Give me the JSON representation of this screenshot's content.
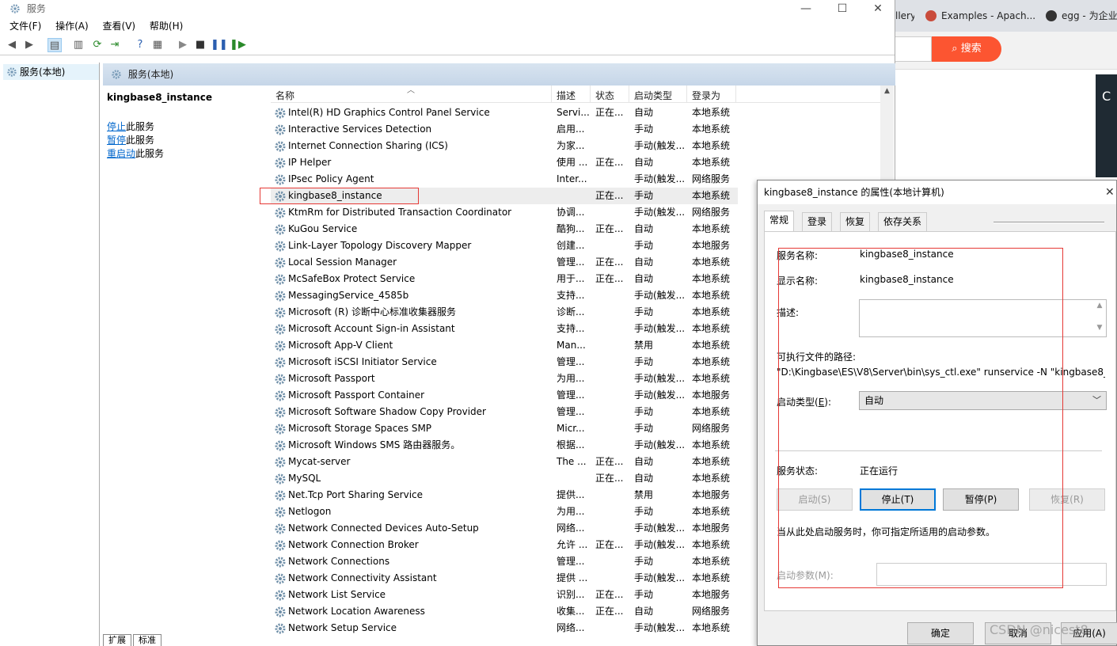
{
  "browser": {
    "tabs": [
      "llery",
      "Examples - Apach...",
      "egg - 为企业"
    ],
    "search_button": "搜索",
    "panel_letter": "C"
  },
  "window": {
    "title": "服务",
    "menu": [
      "文件(F)",
      "操作(A)",
      "查看(V)",
      "帮助(H)"
    ]
  },
  "tree": {
    "root": "服务(本地)"
  },
  "panel": {
    "header": "服务(本地)",
    "selected_service": "kingbase8_instance",
    "actions": [
      {
        "link": "停止",
        "rest": "此服务"
      },
      {
        "link": "暂停",
        "rest": "此服务"
      },
      {
        "link": "重启动",
        "rest": "此服务"
      }
    ]
  },
  "list": {
    "columns": {
      "name": "名称",
      "desc": "描述",
      "status": "状态",
      "startup": "启动类型",
      "logon": "登录为"
    },
    "rows": [
      [
        "Intel(R) HD Graphics Control Panel Service",
        "Servi...",
        "正在...",
        "自动",
        "本地系统"
      ],
      [
        "Interactive Services Detection",
        "启用...",
        "",
        "手动",
        "本地系统"
      ],
      [
        "Internet Connection Sharing (ICS)",
        "为家...",
        "",
        "手动(触发...",
        "本地系统"
      ],
      [
        "IP Helper",
        "使用 ...",
        "正在...",
        "自动",
        "本地系统"
      ],
      [
        "IPsec Policy Agent",
        "Inter...",
        "",
        "手动(触发...",
        "网络服务"
      ],
      [
        "kingbase8_instance",
        "",
        "正在...",
        "手动",
        "本地系统"
      ],
      [
        "KtmRm for Distributed Transaction Coordinator",
        "协调...",
        "",
        "手动(触发...",
        "网络服务"
      ],
      [
        "KuGou Service",
        "酷狗...",
        "正在...",
        "自动",
        "本地系统"
      ],
      [
        "Link-Layer Topology Discovery Mapper",
        "创建...",
        "",
        "手动",
        "本地服务"
      ],
      [
        "Local Session Manager",
        "管理...",
        "正在...",
        "自动",
        "本地系统"
      ],
      [
        "McSafeBox Protect Service",
        "用于...",
        "正在...",
        "自动",
        "本地系统"
      ],
      [
        "MessagingService_4585b",
        "支持...",
        "",
        "手动(触发...",
        "本地系统"
      ],
      [
        "Microsoft (R) 诊断中心标准收集器服务",
        "诊断...",
        "",
        "手动",
        "本地系统"
      ],
      [
        "Microsoft Account Sign-in Assistant",
        "支持...",
        "",
        "手动(触发...",
        "本地系统"
      ],
      [
        "Microsoft App-V Client",
        "Man...",
        "",
        "禁用",
        "本地系统"
      ],
      [
        "Microsoft iSCSI Initiator Service",
        "管理...",
        "",
        "手动",
        "本地系统"
      ],
      [
        "Microsoft Passport",
        "为用...",
        "",
        "手动(触发...",
        "本地系统"
      ],
      [
        "Microsoft Passport Container",
        "管理...",
        "",
        "手动(触发...",
        "本地服务"
      ],
      [
        "Microsoft Software Shadow Copy Provider",
        "管理...",
        "",
        "手动",
        "本地系统"
      ],
      [
        "Microsoft Storage Spaces SMP",
        "Micr...",
        "",
        "手动",
        "网络服务"
      ],
      [
        "Microsoft Windows SMS 路由器服务。",
        "根据...",
        "",
        "手动(触发...",
        "本地系统"
      ],
      [
        "Mycat-server",
        "The ...",
        "正在...",
        "自动",
        "本地系统"
      ],
      [
        "MySQL",
        "",
        "正在...",
        "自动",
        "本地系统"
      ],
      [
        "Net.Tcp Port Sharing Service",
        "提供...",
        "",
        "禁用",
        "本地服务"
      ],
      [
        "Netlogon",
        "为用...",
        "",
        "手动",
        "本地系统"
      ],
      [
        "Network Connected Devices Auto-Setup",
        "网络...",
        "",
        "手动(触发...",
        "本地服务"
      ],
      [
        "Network Connection Broker",
        "允许 ...",
        "正在...",
        "手动(触发...",
        "本地系统"
      ],
      [
        "Network Connections",
        "管理...",
        "",
        "手动",
        "本地系统"
      ],
      [
        "Network Connectivity Assistant",
        "提供 ...",
        "",
        "手动(触发...",
        "本地系统"
      ],
      [
        "Network List Service",
        "识别...",
        "正在...",
        "手动",
        "本地服务"
      ],
      [
        "Network Location Awareness",
        "收集...",
        "正在...",
        "自动",
        "网络服务"
      ],
      [
        "Network Setup Service",
        "网络...",
        "",
        "手动(触发...",
        "本地系统"
      ]
    ]
  },
  "bottom_tabs": [
    "扩展",
    "标准"
  ],
  "dialog": {
    "title": "kingbase8_instance 的属性(本地计算机)",
    "tabs": [
      "常规",
      "登录",
      "恢复",
      "依存关系"
    ],
    "service_name_label": "服务名称:",
    "service_name": "kingbase8_instance",
    "display_name_label": "显示名称:",
    "display_name": "kingbase8_instance",
    "description_label": "描述:",
    "exe_path_label": "可执行文件的路径:",
    "exe_path": "\"D:\\Kingbase\\ES\\V8\\Server\\bin\\sys_ctl.exe\" runservice -N \"kingbase8_in",
    "startup_type_label": "启动类型(E):",
    "startup_type": "自动",
    "status_label": "服务状态:",
    "status": "正在运行",
    "buttons": {
      "start": "启动(S)",
      "stop": "停止(T)",
      "pause": "暂停(P)",
      "resume": "恢复(R)"
    },
    "hint": "当从此处启动服务时，你可指定所适用的启动参数。",
    "params_label": "启动参数(M):",
    "footer": {
      "ok": "确定",
      "cancel": "取消",
      "apply": "应用(A)"
    }
  },
  "watermark": "CSDN @nicest8",
  "colors": {
    "highlight_box": "#e53935",
    "search_button": "#fc5531",
    "link": "#0066cc"
  }
}
